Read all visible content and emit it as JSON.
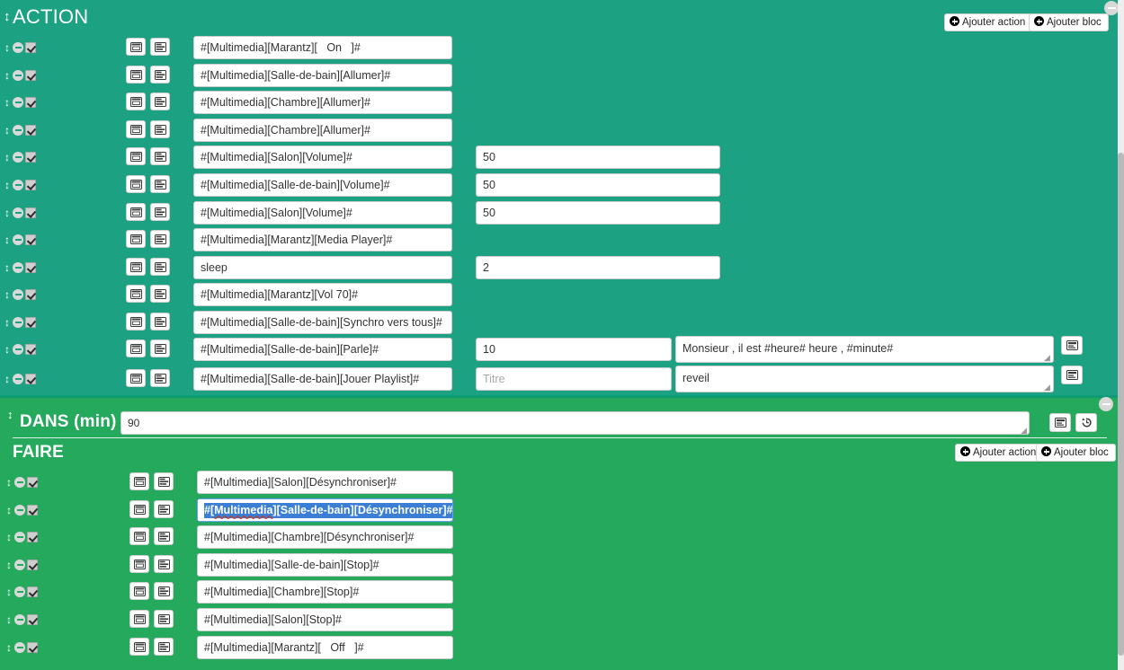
{
  "window": {
    "bg_teal": "#1ca183",
    "bg_green": "#25a95c"
  },
  "action_block": {
    "title": "ACTION",
    "drag_handle": "↕",
    "collapse_label": "−",
    "add_action_label": "Ajouter action",
    "add_bloc_label": "Ajouter bloc",
    "rows": [
      {
        "command": "#[Multimedia][Marantz][   On   ]#",
        "value": null,
        "value_placeholder": null,
        "message": null
      },
      {
        "command": "#[Multimedia][Salle-de-bain][Allumer]#",
        "value": null,
        "value_placeholder": null,
        "message": null
      },
      {
        "command": "#[Multimedia][Chambre][Allumer]#",
        "value": null,
        "value_placeholder": null,
        "message": null
      },
      {
        "command": "#[Multimedia][Chambre][Allumer]#",
        "value": null,
        "value_placeholder": null,
        "message": null
      },
      {
        "command": "#[Multimedia][Salon][Volume]#",
        "value": "50",
        "value_placeholder": null,
        "message": null
      },
      {
        "command": "#[Multimedia][Salle-de-bain][Volume]#",
        "value": "50",
        "value_placeholder": null,
        "message": null
      },
      {
        "command": "#[Multimedia][Salon][Volume]#",
        "value": "50",
        "value_placeholder": null,
        "message": null
      },
      {
        "command": "#[Multimedia][Marantz][Media Player]#",
        "value": null,
        "value_placeholder": null,
        "message": null
      },
      {
        "command": "sleep",
        "value": "2",
        "value_placeholder": null,
        "message": null
      },
      {
        "command": "#[Multimedia][Marantz][Vol 70]#",
        "value": null,
        "value_placeholder": null,
        "message": null
      },
      {
        "command": "#[Multimedia][Salle-de-bain][Synchro vers tous]#",
        "value": null,
        "value_placeholder": null,
        "message": null
      },
      {
        "command": "#[Multimedia][Salle-de-bain][Parle]#",
        "value": "10",
        "value_placeholder": null,
        "message": "Monsieur , il est #heure# heure , #minute#"
      },
      {
        "command": "#[Multimedia][Salle-de-bain][Jouer Playlist]#",
        "value": "",
        "value_placeholder": "Titre",
        "message": "reveil"
      }
    ]
  },
  "then_block": {
    "dans_label": "DANS (min)",
    "dans_value": "90",
    "drag_handle": "↕",
    "collapse_label": "−",
    "faire_title": "FAIRE",
    "add_action_label": "Ajouter action",
    "add_bloc_label": "Ajouter bloc",
    "rows": [
      {
        "command": "#[Multimedia][Salon][Désynchroniser]#",
        "selected": false
      },
      {
        "command": "#[Multimedia][Salle-de-bain][Désynchroniser]#",
        "selected": true,
        "selected_parts": {
          "misspelled": "Multimedia",
          "prefix": "#[",
          "mid": "][Salle-de-bain][Désynchroniser]#"
        }
      },
      {
        "command": "#[Multimedia][Chambre][Désynchroniser]#",
        "selected": false
      },
      {
        "command": "#[Multimedia][Salle-de-bain][Stop]#",
        "selected": false
      },
      {
        "command": "#[Multimedia][Chambre][Stop]#",
        "selected": false
      },
      {
        "command": "#[Multimedia][Salon][Stop]#",
        "selected": false
      },
      {
        "command": "#[Multimedia][Marantz][   Off   ]#",
        "selected": false
      }
    ]
  },
  "icons": {
    "row_move": "move-handle-icon",
    "row_remove": "remove-row-icon",
    "row_enabled": "enabled-checkbox",
    "expression_button": "expression-editor-icon",
    "options_button": "row-options-icon",
    "message_button": "message-editor-icon",
    "history_button": "history-icon"
  }
}
